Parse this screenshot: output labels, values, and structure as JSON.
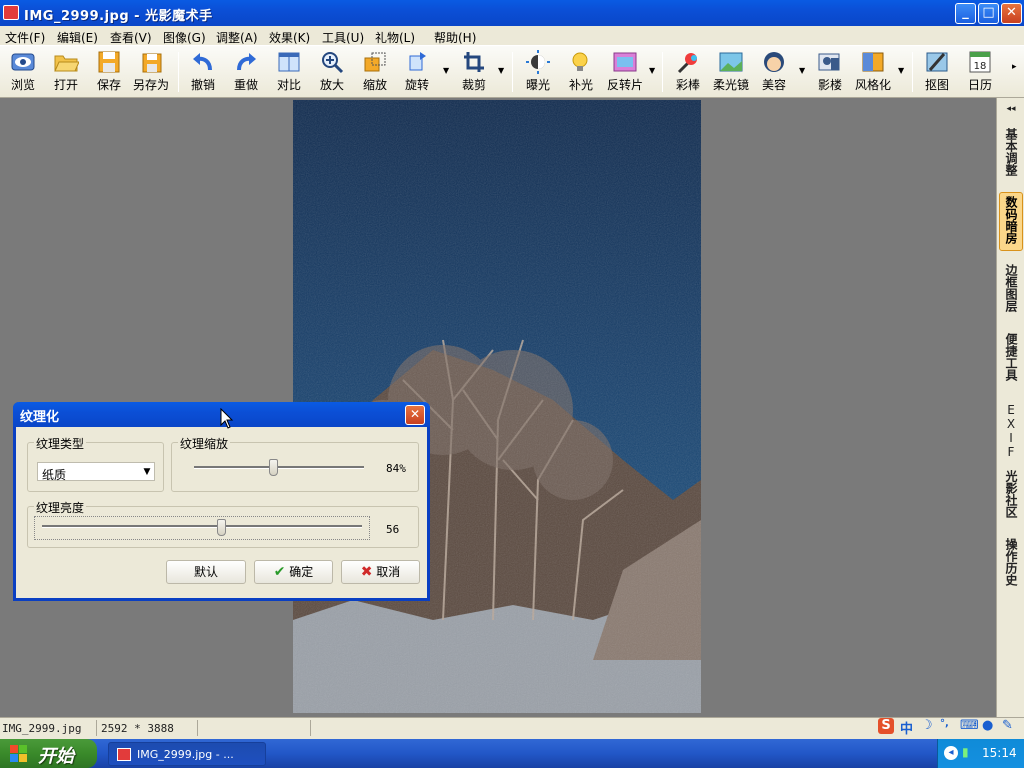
{
  "window": {
    "title": "IMG_2999.jpg - 光影魔术手",
    "min": "_",
    "max": "□",
    "close": "✕"
  },
  "menu": [
    "文件(F)",
    "编辑(E)",
    "查看(V)",
    "图像(G)",
    "调整(A)",
    "效果(K)",
    "工具(U)",
    "礼物(L)",
    "帮助(H)"
  ],
  "toolbar": [
    {
      "label": "浏览",
      "icon": "eye-icon"
    },
    {
      "label": "打开",
      "icon": "folder-open-icon"
    },
    {
      "label": "保存",
      "icon": "save-icon"
    },
    {
      "label": "另存为",
      "icon": "save-as-icon"
    },
    {
      "label": "撤销",
      "icon": "undo-icon"
    },
    {
      "label": "重做",
      "icon": "redo-icon"
    },
    {
      "label": "对比",
      "icon": "compare-icon"
    },
    {
      "label": "放大",
      "icon": "zoom-in-icon"
    },
    {
      "label": "缩放",
      "icon": "resize-icon"
    },
    {
      "label": "旋转",
      "icon": "rotate-icon"
    },
    {
      "label": "裁剪",
      "icon": "crop-icon"
    },
    {
      "label": "曝光",
      "icon": "exposure-icon"
    },
    {
      "label": "补光",
      "icon": "fill-light-icon"
    },
    {
      "label": "反转片",
      "icon": "reversal-film-icon"
    },
    {
      "label": "彩棒",
      "icon": "color-wand-icon"
    },
    {
      "label": "柔光镜",
      "icon": "soft-light-icon"
    },
    {
      "label": "美容",
      "icon": "beauty-icon"
    },
    {
      "label": "影楼",
      "icon": "studio-icon"
    },
    {
      "label": "风格化",
      "icon": "stylize-icon"
    },
    {
      "label": "抠图",
      "icon": "cutout-icon"
    },
    {
      "label": "日历",
      "icon": "calendar-icon",
      "badge": "18"
    }
  ],
  "right_panel": {
    "tabs": [
      "基本调整",
      "数码暗房",
      "边框图层",
      "便捷工具",
      "EXIF",
      "光影社区",
      "操作历史"
    ],
    "active": "数码暗房",
    "collapse": "◂◂"
  },
  "status": {
    "filename": "IMG_2999.jpg",
    "dimensions": "2592 * 3888"
  },
  "ime": {
    "logo": "S",
    "mode": "中"
  },
  "taskbar": {
    "start": "开始",
    "task": "IMG_2999.jpg - ...",
    "clock": "15:14"
  },
  "dialog": {
    "title": "纹理化",
    "close": "✕",
    "texture_type_label": "纹理类型",
    "texture_type_value": "纸质",
    "texture_scale_label": "纹理缩放",
    "texture_scale_value": "84%",
    "texture_scale_fraction": 0.84,
    "texture_brightness_label": "纹理亮度",
    "texture_brightness_value": "56",
    "texture_brightness_fraction": 0.56,
    "buttons": {
      "default": "默认",
      "ok": "确定",
      "cancel": "取消"
    }
  },
  "colors": {
    "titlebar": "#0b4fd6",
    "panel_bg": "#ece9d8",
    "workspace": "#7a7a7a",
    "active_tab": "#fbd78a",
    "taskbar": "#2257c7",
    "start": "#3a8a2a"
  }
}
